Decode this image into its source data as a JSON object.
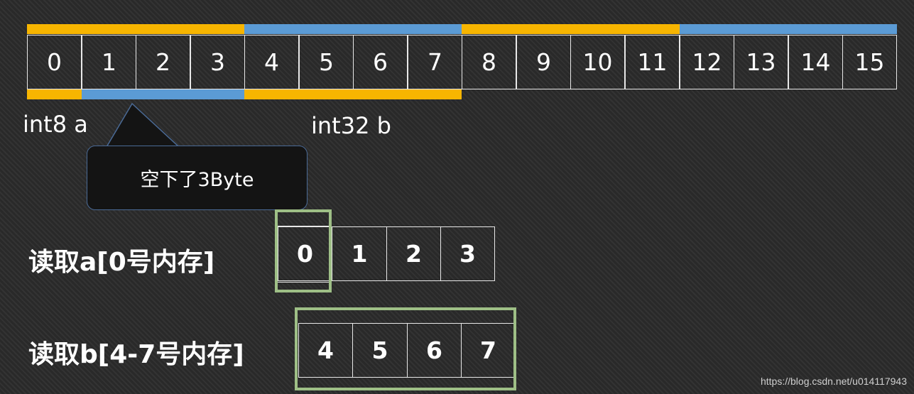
{
  "memory_cells": [
    "0",
    "1",
    "2",
    "3",
    "4",
    "5",
    "6",
    "7",
    "8",
    "9",
    "10",
    "11",
    "12",
    "13",
    "14",
    "15"
  ],
  "labels": {
    "int8": "int8 a",
    "int32": "int32 b",
    "callout": "空下了3Byte"
  },
  "read_a": {
    "title": "读取a[0号内存]",
    "cells": [
      "0",
      "1",
      "2",
      "3"
    ]
  },
  "read_b": {
    "title": "读取b[4-7号内存]",
    "cells": [
      "4",
      "5",
      "6",
      "7"
    ]
  },
  "watermark": "https://blog.csdn.net/u014117943",
  "colors": {
    "orange": "#f7b500",
    "blue": "#5b9bd5",
    "highlight_green": "#9ebf86",
    "callout_border": "#4a6a96"
  }
}
